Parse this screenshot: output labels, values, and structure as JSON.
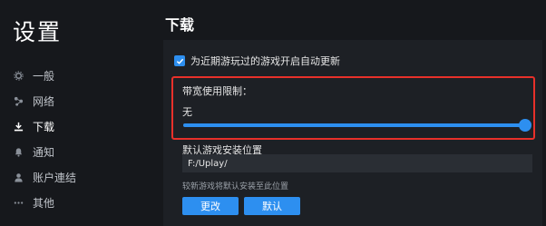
{
  "sidebar": {
    "title": "设置",
    "items": [
      {
        "label": "一般",
        "icon": "gear-icon"
      },
      {
        "label": "网络",
        "icon": "network-icon"
      },
      {
        "label": "下载",
        "icon": "download-icon",
        "active": true
      },
      {
        "label": "通知",
        "icon": "bell-icon"
      },
      {
        "label": "账户連结",
        "icon": "user-icon"
      },
      {
        "label": "其他",
        "icon": "more-icon"
      }
    ]
  },
  "main": {
    "title": "下载",
    "auto_update_label": "为近期游玩过的游戏开启自动更新",
    "auto_update_checked": true,
    "bandwidth": {
      "label": "带宽使用限制：",
      "value": "无",
      "slider_fraction": 1.0
    },
    "install_path": {
      "label": "默认游戏安装位置",
      "value": "F:/Uplay/",
      "hint": "较新游戏将默认安装至此位置"
    },
    "buttons": {
      "change": "更改",
      "default": "默认"
    }
  },
  "colors": {
    "accent": "#2d8ff0",
    "highlight_border": "#e8302a",
    "background": "#16181c",
    "panel": "#1d2025"
  }
}
